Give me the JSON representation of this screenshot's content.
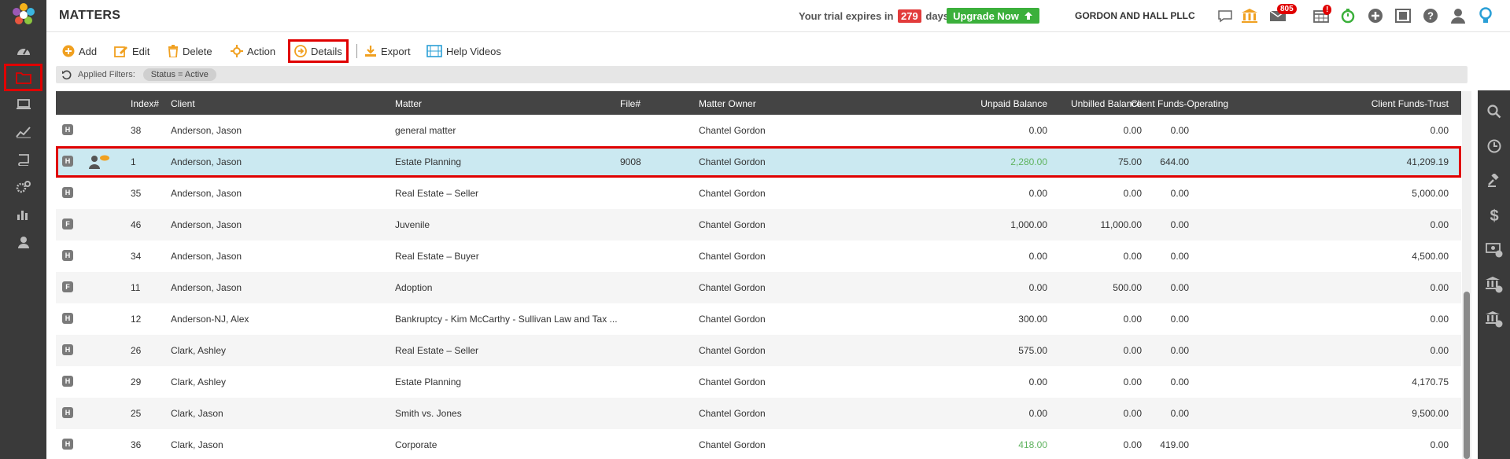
{
  "header": {
    "title": "MATTERS",
    "trial_prefix": "Your trial expires in",
    "trial_days": "279",
    "trial_suffix": "days.",
    "upgrade_label": "Upgrade Now",
    "firm_name": "GORDON AND HALL PLLC",
    "mail_badge": "805",
    "calendar_badge": "!"
  },
  "toolbar": {
    "add": "Add",
    "edit": "Edit",
    "delete": "Delete",
    "action": "Action",
    "details": "Details",
    "export": "Export",
    "help_videos": "Help Videos"
  },
  "filters": {
    "label": "Applied Filters:",
    "chip": "Status = Active"
  },
  "table": {
    "columns": {
      "index": "Index#",
      "client": "Client",
      "matter": "Matter",
      "file": "File#",
      "owner": "Matter Owner",
      "unpaid": "Unpaid Balance",
      "unbilled": "Unbilled Balance",
      "operating": "Client Funds-Operating",
      "trust": "Client Funds-Trust"
    },
    "rows": [
      {
        "tag": "H",
        "index": "38",
        "client": "Anderson, Jason",
        "matter": "general matter",
        "file": "",
        "owner": "Chantel Gordon",
        "unpaid": "0.00",
        "unbilled": "0.00",
        "operating": "0.00",
        "trust": "0.00"
      },
      {
        "tag": "H",
        "index": "1",
        "client": "Anderson, Jason",
        "matter": "Estate Planning",
        "file": "9008",
        "owner": "Chantel Gordon",
        "unpaid": "2,280.00",
        "unbilled": "75.00",
        "operating": "644.00",
        "trust": "41,209.19"
      },
      {
        "tag": "H",
        "index": "35",
        "client": "Anderson, Jason",
        "matter": "Real Estate – Seller",
        "file": "",
        "owner": "Chantel Gordon",
        "unpaid": "0.00",
        "unbilled": "0.00",
        "operating": "0.00",
        "trust": "5,000.00"
      },
      {
        "tag": "F",
        "index": "46",
        "client": "Anderson, Jason",
        "matter": "Juvenile",
        "file": "",
        "owner": "Chantel Gordon",
        "unpaid": "1,000.00",
        "unbilled": "11,000.00",
        "operating": "0.00",
        "trust": "0.00"
      },
      {
        "tag": "H",
        "index": "34",
        "client": "Anderson, Jason",
        "matter": "Real Estate – Buyer",
        "file": "",
        "owner": "Chantel Gordon",
        "unpaid": "0.00",
        "unbilled": "0.00",
        "operating": "0.00",
        "trust": "4,500.00"
      },
      {
        "tag": "F",
        "index": "11",
        "client": "Anderson, Jason",
        "matter": "Adoption",
        "file": "",
        "owner": "Chantel Gordon",
        "unpaid": "0.00",
        "unbilled": "500.00",
        "operating": "0.00",
        "trust": "0.00"
      },
      {
        "tag": "H",
        "index": "12",
        "client": "Anderson-NJ, Alex",
        "matter": "Bankruptcy - Kim McCarthy - Sullivan Law and Tax ...",
        "file": "",
        "owner": "Chantel Gordon",
        "unpaid": "300.00",
        "unbilled": "0.00",
        "operating": "0.00",
        "trust": "0.00"
      },
      {
        "tag": "H",
        "index": "26",
        "client": "Clark, Ashley",
        "matter": "Real Estate – Seller",
        "file": "",
        "owner": "Chantel Gordon",
        "unpaid": "575.00",
        "unbilled": "0.00",
        "operating": "0.00",
        "trust": "0.00"
      },
      {
        "tag": "H",
        "index": "29",
        "client": "Clark, Ashley",
        "matter": "Estate Planning",
        "file": "",
        "owner": "Chantel Gordon",
        "unpaid": "0.00",
        "unbilled": "0.00",
        "operating": "0.00",
        "trust": "4,170.75"
      },
      {
        "tag": "H",
        "index": "25",
        "client": "Clark, Jason",
        "matter": "Smith vs. Jones",
        "file": "",
        "owner": "Chantel Gordon",
        "unpaid": "0.00",
        "unbilled": "0.00",
        "operating": "0.00",
        "trust": "9,500.00"
      },
      {
        "tag": "H",
        "index": "36",
        "client": "Clark, Jason",
        "matter": "Corporate",
        "file": "",
        "owner": "Chantel Gordon",
        "unpaid": "418.00",
        "unbilled": "0.00",
        "operating": "419.00",
        "trust": "0.00"
      }
    ]
  },
  "colors": {
    "sidebar": "#3a3a3a",
    "accent_orange": "#f0a020",
    "upgrade_green": "#3bb03b",
    "highlight_red": "#e00000",
    "selected_row": "#cbe9f1",
    "positive_green": "#5fb35f"
  }
}
